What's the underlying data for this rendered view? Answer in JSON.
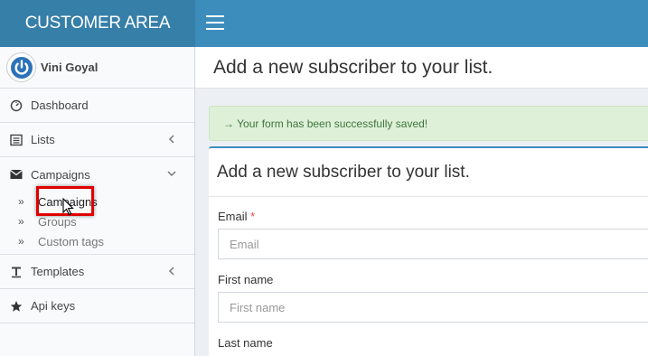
{
  "header": {
    "brand": "CUSTOMER AREA"
  },
  "sidebar": {
    "user_name": "Vini Goyal",
    "items": [
      {
        "label": "Dashboard",
        "icon": "dashboard-icon"
      },
      {
        "label": "Lists",
        "icon": "list-icon"
      },
      {
        "label": "Campaigns",
        "icon": "envelope-icon"
      },
      {
        "label": "Templates",
        "icon": "text-icon"
      },
      {
        "label": "Api keys",
        "icon": "star-icon"
      }
    ],
    "campaigns_sub": [
      {
        "label": "Campaigns"
      },
      {
        "label": "Groups"
      },
      {
        "label": "Custom tags"
      }
    ]
  },
  "main": {
    "page_title": "Add a new subscriber to your list.",
    "alert": "→ Your form has been successfully saved!",
    "box_title": "Add a new subscriber to your list.",
    "fields": [
      {
        "label": "Email",
        "required_mark": "*",
        "placeholder": "Email"
      },
      {
        "label": "First name",
        "placeholder": "First name"
      },
      {
        "label": "Last name"
      }
    ]
  },
  "colors": {
    "header_bg": "#3c8dbc",
    "brand_bg": "#367fa9",
    "alert_bg": "#dff0d8",
    "alert_text": "#3c763d",
    "highlight": "#e00000"
  }
}
